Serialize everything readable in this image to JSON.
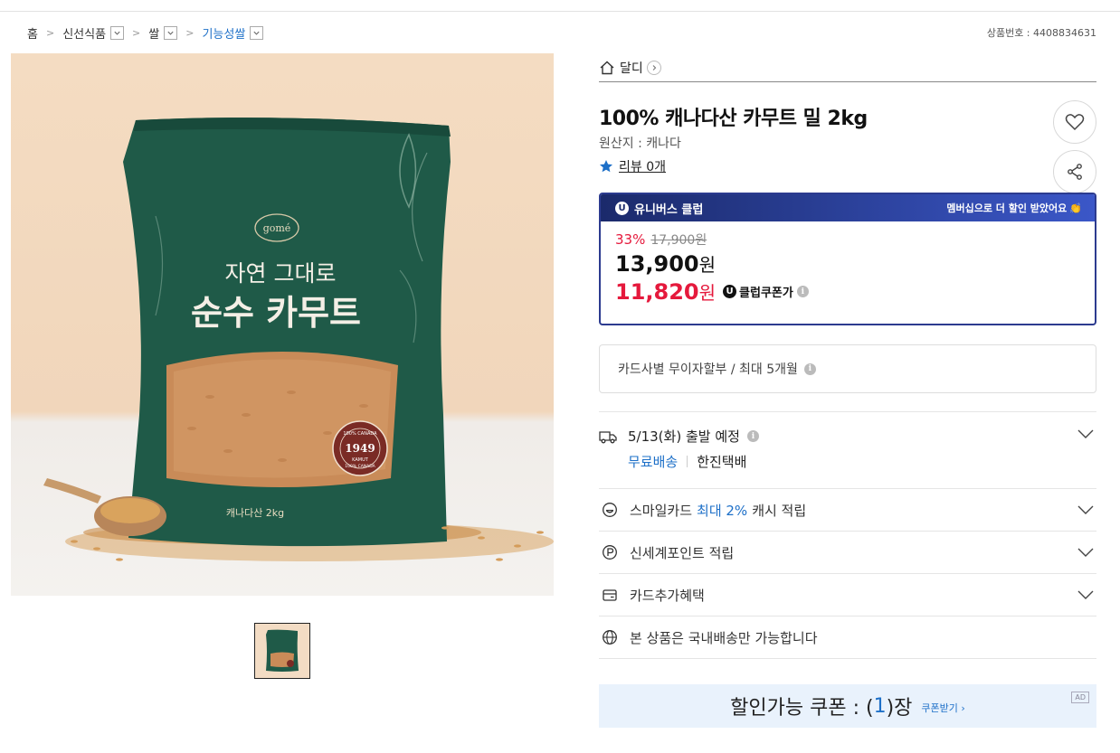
{
  "breadcrumb": {
    "items": [
      {
        "label": "홈",
        "dropdown": false
      },
      {
        "label": "신선식품",
        "dropdown": true
      },
      {
        "label": "쌀",
        "dropdown": true
      },
      {
        "label": "기능성쌀",
        "dropdown": true
      }
    ]
  },
  "product_no": "상품번호 : 4408834631",
  "package": {
    "brand": "gomé",
    "line1": "자연 그대로",
    "line2": "순수 카무트",
    "origin_note": "캐나다산 2kg",
    "seal_year": "1949",
    "seal_top": "100% CANADA",
    "seal_bottom": "100% CANADA",
    "seal_mid": "KAMUT"
  },
  "seller": {
    "name": "달디"
  },
  "product": {
    "title": "100% 캐나다산 카무트 밀 2kg",
    "origin": "원산지 : 캐나다",
    "review_label": "리뷰 0개"
  },
  "club": {
    "badge": "U",
    "name": "유니버스 클럽",
    "promo": "멤버십으로 더 할인 받았어요",
    "discount_rate": "33%",
    "original_price": "17,900원",
    "sale_price": "13,900",
    "sale_unit": "원",
    "coupon_price": "11,820",
    "coupon_unit": "원",
    "coupon_label": "클럽쿠폰가"
  },
  "installment": {
    "text": "카드사별 무이자할부 / 최대 5개월"
  },
  "shipping": {
    "date": "5/13(화) 출발 예정",
    "free_label": "무료배송",
    "courier": "한진택배"
  },
  "benefits": [
    {
      "prefix": "스마일카드",
      "highlight": "최대 2%",
      "suffix": "캐시 적립",
      "icon": "smile-icon",
      "expandable": true
    },
    {
      "prefix": "신세계포인트 적립",
      "highlight": "",
      "suffix": "",
      "icon": "point-icon",
      "expandable": true
    },
    {
      "prefix": "카드추가혜택",
      "highlight": "",
      "suffix": "",
      "icon": "card-icon",
      "expandable": true
    },
    {
      "prefix": "본 상품은 국내배송만 가능합니다",
      "highlight": "",
      "suffix": "",
      "icon": "globe-icon",
      "expandable": false
    }
  ],
  "coupon_bar": {
    "label": "할인가능 쿠폰 : (",
    "count": "1",
    "suffix": ")장",
    "get_label": "쿠폰받기 ›",
    "ad": "AD"
  },
  "colors": {
    "accent_blue": "#1e70c8",
    "sale_red": "#e5193c",
    "club_navy": "#1b2a6b",
    "pouch_green": "#1f5a48"
  }
}
